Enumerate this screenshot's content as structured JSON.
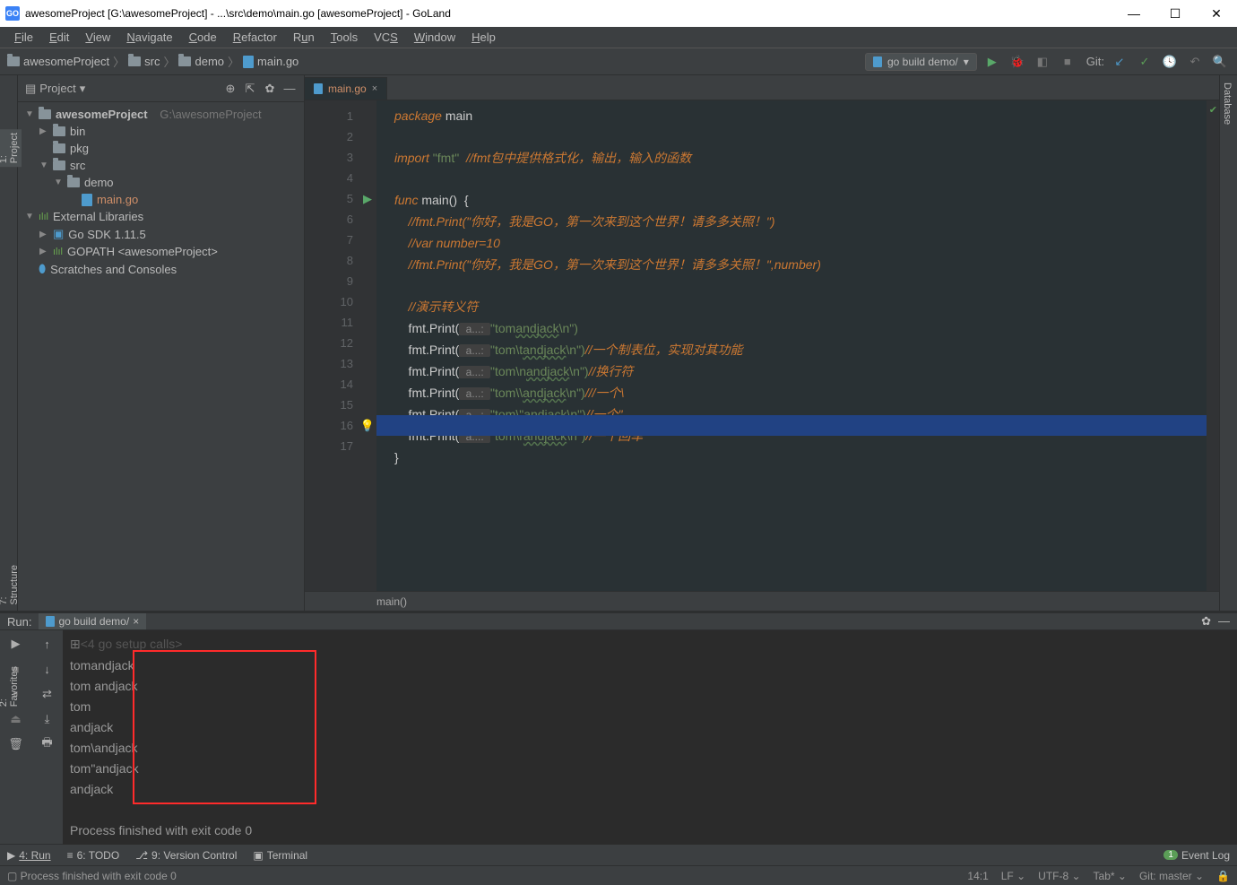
{
  "title": "awesomeProject [G:\\awesomeProject] - ...\\src\\demo\\main.go [awesomeProject] - GoLand",
  "menu": [
    "File",
    "Edit",
    "View",
    "Navigate",
    "Code",
    "Refactor",
    "Run",
    "Tools",
    "VCS",
    "Window",
    "Help"
  ],
  "breadcrumbs": [
    "awesomeProject",
    "src",
    "demo",
    "main.go"
  ],
  "runConfig": "go build demo/",
  "gitLabel": "Git:",
  "sidebar": {
    "header": "Project",
    "project": "awesomeProject",
    "projectPath": "G:\\awesomeProject",
    "bin": "bin",
    "pkg": "pkg",
    "src": "src",
    "demo": "demo",
    "mainfile": "main.go",
    "ext": "External Libraries",
    "sdk": "Go SDK 1.11.5",
    "gopath": "GOPATH <awesomeProject>",
    "scratches": "Scratches and Consoles"
  },
  "leftTabs": {
    "project": "1: Project",
    "structure": "7: Structure",
    "favorites": "2: Favorites"
  },
  "rightTab": "Database",
  "tab": {
    "name": "main.go"
  },
  "code": {
    "l1_pkg": "package ",
    "l1_main": "main",
    "l3_imp": "import ",
    "l3_fmt": "\"fmt\"",
    "l3_c": "  //fmt包中提供格式化，输出，输入的函数",
    "l5_func": "func ",
    "l5_main": "main",
    "l5_paren": "()  {",
    "l6": "    //fmt.Print(\"你好，我是GO，第一次来到这个世界！请多多关照！\")",
    "l7": "    //var number=10",
    "l8": "    //fmt.Print(\"你好，我是GO，第一次来到这个世界！请多多关照！\",number)",
    "l10": "    //演示转义符",
    "l11a": "    fmt.Print(",
    "l11h": " a...: ",
    "l11b": "\"tom",
    "l11u": "andjack",
    "l11c": "\\n\")",
    "l12a": "    fmt.Print(",
    "l12h": " a...: ",
    "l12b": "\"tom\\t",
    "l12u": "andjack",
    "l12c": "\\n\")",
    "l12cm": "//一个制表位，实现对其功能",
    "l13a": "    fmt.Print(",
    "l13h": " a...: ",
    "l13b": "\"tom\\n",
    "l13u": "andjack",
    "l13c": "\\n\")",
    "l13cm": "//换行符",
    "l14a": "    fmt.Print(",
    "l14h": " a...: ",
    "l14b": "\"tom\\\\",
    "l14u": "andjack",
    "l14c": "\\n\")",
    "l14cm": "///一个\\",
    "l15a": "    fmt.Print(",
    "l15h": " a...: ",
    "l15b": "\"tom\\\"",
    "l15u": "andjack",
    "l15c": "\\n\")",
    "l15cm": "//一个\"",
    "l16a": "    fmt.Print(",
    "l16h": " a...: ",
    "l16b": "\"tom\\r",
    "l16u": "andjack",
    "l16c": "\\n\")",
    "l16cm": "//一个回车",
    "l17": "}"
  },
  "breadbar": "main()",
  "run": {
    "label": "Run:",
    "tab": "go build demo/",
    "setup": "<4 go setup calls>",
    "out": [
      "tomandjack",
      "tom andjack",
      "tom",
      "andjack",
      "tom\\andjack",
      "tom\"andjack",
      "andjack"
    ],
    "finished": "Process finished with exit code 0"
  },
  "bottom": {
    "run": "4: Run",
    "todo": "6: TODO",
    "vc": "9: Version Control",
    "term": "Terminal",
    "log": "Event Log"
  },
  "status": {
    "msg": "Process finished with exit code 0",
    "pos": "14:1",
    "lf": "LF",
    "enc": "UTF-8",
    "tab": "Tab*",
    "git": "Git: master",
    "lock": "🔒"
  }
}
